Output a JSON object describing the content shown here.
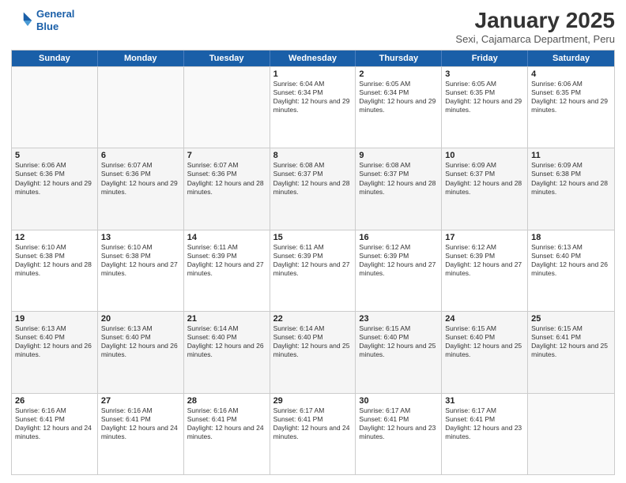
{
  "header": {
    "logo_line1": "General",
    "logo_line2": "Blue",
    "title": "January 2025",
    "subtitle": "Sexi, Cajamarca Department, Peru"
  },
  "weekdays": [
    "Sunday",
    "Monday",
    "Tuesday",
    "Wednesday",
    "Thursday",
    "Friday",
    "Saturday"
  ],
  "rows": [
    [
      {
        "day": "",
        "info": ""
      },
      {
        "day": "",
        "info": ""
      },
      {
        "day": "",
        "info": ""
      },
      {
        "day": "1",
        "info": "Sunrise: 6:04 AM\nSunset: 6:34 PM\nDaylight: 12 hours and 29 minutes."
      },
      {
        "day": "2",
        "info": "Sunrise: 6:05 AM\nSunset: 6:34 PM\nDaylight: 12 hours and 29 minutes."
      },
      {
        "day": "3",
        "info": "Sunrise: 6:05 AM\nSunset: 6:35 PM\nDaylight: 12 hours and 29 minutes."
      },
      {
        "day": "4",
        "info": "Sunrise: 6:06 AM\nSunset: 6:35 PM\nDaylight: 12 hours and 29 minutes."
      }
    ],
    [
      {
        "day": "5",
        "info": "Sunrise: 6:06 AM\nSunset: 6:36 PM\nDaylight: 12 hours and 29 minutes."
      },
      {
        "day": "6",
        "info": "Sunrise: 6:07 AM\nSunset: 6:36 PM\nDaylight: 12 hours and 29 minutes."
      },
      {
        "day": "7",
        "info": "Sunrise: 6:07 AM\nSunset: 6:36 PM\nDaylight: 12 hours and 28 minutes."
      },
      {
        "day": "8",
        "info": "Sunrise: 6:08 AM\nSunset: 6:37 PM\nDaylight: 12 hours and 28 minutes."
      },
      {
        "day": "9",
        "info": "Sunrise: 6:08 AM\nSunset: 6:37 PM\nDaylight: 12 hours and 28 minutes."
      },
      {
        "day": "10",
        "info": "Sunrise: 6:09 AM\nSunset: 6:37 PM\nDaylight: 12 hours and 28 minutes."
      },
      {
        "day": "11",
        "info": "Sunrise: 6:09 AM\nSunset: 6:38 PM\nDaylight: 12 hours and 28 minutes."
      }
    ],
    [
      {
        "day": "12",
        "info": "Sunrise: 6:10 AM\nSunset: 6:38 PM\nDaylight: 12 hours and 28 minutes."
      },
      {
        "day": "13",
        "info": "Sunrise: 6:10 AM\nSunset: 6:38 PM\nDaylight: 12 hours and 27 minutes."
      },
      {
        "day": "14",
        "info": "Sunrise: 6:11 AM\nSunset: 6:39 PM\nDaylight: 12 hours and 27 minutes."
      },
      {
        "day": "15",
        "info": "Sunrise: 6:11 AM\nSunset: 6:39 PM\nDaylight: 12 hours and 27 minutes."
      },
      {
        "day": "16",
        "info": "Sunrise: 6:12 AM\nSunset: 6:39 PM\nDaylight: 12 hours and 27 minutes."
      },
      {
        "day": "17",
        "info": "Sunrise: 6:12 AM\nSunset: 6:39 PM\nDaylight: 12 hours and 27 minutes."
      },
      {
        "day": "18",
        "info": "Sunrise: 6:13 AM\nSunset: 6:40 PM\nDaylight: 12 hours and 26 minutes."
      }
    ],
    [
      {
        "day": "19",
        "info": "Sunrise: 6:13 AM\nSunset: 6:40 PM\nDaylight: 12 hours and 26 minutes."
      },
      {
        "day": "20",
        "info": "Sunrise: 6:13 AM\nSunset: 6:40 PM\nDaylight: 12 hours and 26 minutes."
      },
      {
        "day": "21",
        "info": "Sunrise: 6:14 AM\nSunset: 6:40 PM\nDaylight: 12 hours and 26 minutes."
      },
      {
        "day": "22",
        "info": "Sunrise: 6:14 AM\nSunset: 6:40 PM\nDaylight: 12 hours and 25 minutes."
      },
      {
        "day": "23",
        "info": "Sunrise: 6:15 AM\nSunset: 6:40 PM\nDaylight: 12 hours and 25 minutes."
      },
      {
        "day": "24",
        "info": "Sunrise: 6:15 AM\nSunset: 6:40 PM\nDaylight: 12 hours and 25 minutes."
      },
      {
        "day": "25",
        "info": "Sunrise: 6:15 AM\nSunset: 6:41 PM\nDaylight: 12 hours and 25 minutes."
      }
    ],
    [
      {
        "day": "26",
        "info": "Sunrise: 6:16 AM\nSunset: 6:41 PM\nDaylight: 12 hours and 24 minutes."
      },
      {
        "day": "27",
        "info": "Sunrise: 6:16 AM\nSunset: 6:41 PM\nDaylight: 12 hours and 24 minutes."
      },
      {
        "day": "28",
        "info": "Sunrise: 6:16 AM\nSunset: 6:41 PM\nDaylight: 12 hours and 24 minutes."
      },
      {
        "day": "29",
        "info": "Sunrise: 6:17 AM\nSunset: 6:41 PM\nDaylight: 12 hours and 24 minutes."
      },
      {
        "day": "30",
        "info": "Sunrise: 6:17 AM\nSunset: 6:41 PM\nDaylight: 12 hours and 23 minutes."
      },
      {
        "day": "31",
        "info": "Sunrise: 6:17 AM\nSunset: 6:41 PM\nDaylight: 12 hours and 23 minutes."
      },
      {
        "day": "",
        "info": ""
      }
    ]
  ]
}
